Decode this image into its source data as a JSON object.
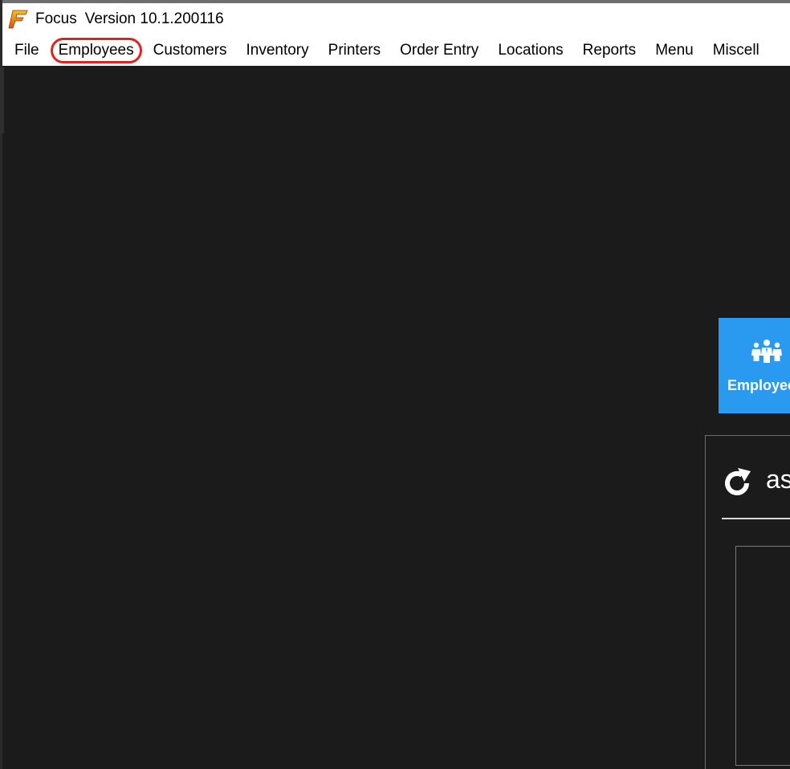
{
  "window": {
    "app_name": "Focus",
    "version": "Version 10.1.200116",
    "logo_icon": "focus-f-logo-icon"
  },
  "menubar": {
    "items": [
      {
        "label": "File"
      },
      {
        "label": "Employees",
        "highlighted": true
      },
      {
        "label": "Customers"
      },
      {
        "label": "Inventory"
      },
      {
        "label": "Printers"
      },
      {
        "label": "Order Entry"
      },
      {
        "label": "Locations"
      },
      {
        "label": "Reports"
      },
      {
        "label": "Menu"
      },
      {
        "label": "Miscell"
      }
    ],
    "highlight_color": "#e0241b"
  },
  "tiles": {
    "employees": {
      "label": "Employee",
      "icon": "employees-group-icon",
      "color": "#2a9af0"
    }
  },
  "panel": {
    "refresh_icon": "refresh-icon",
    "text": "as"
  },
  "colors": {
    "background": "#1b1b1b",
    "titlebar": "#ffffff"
  }
}
